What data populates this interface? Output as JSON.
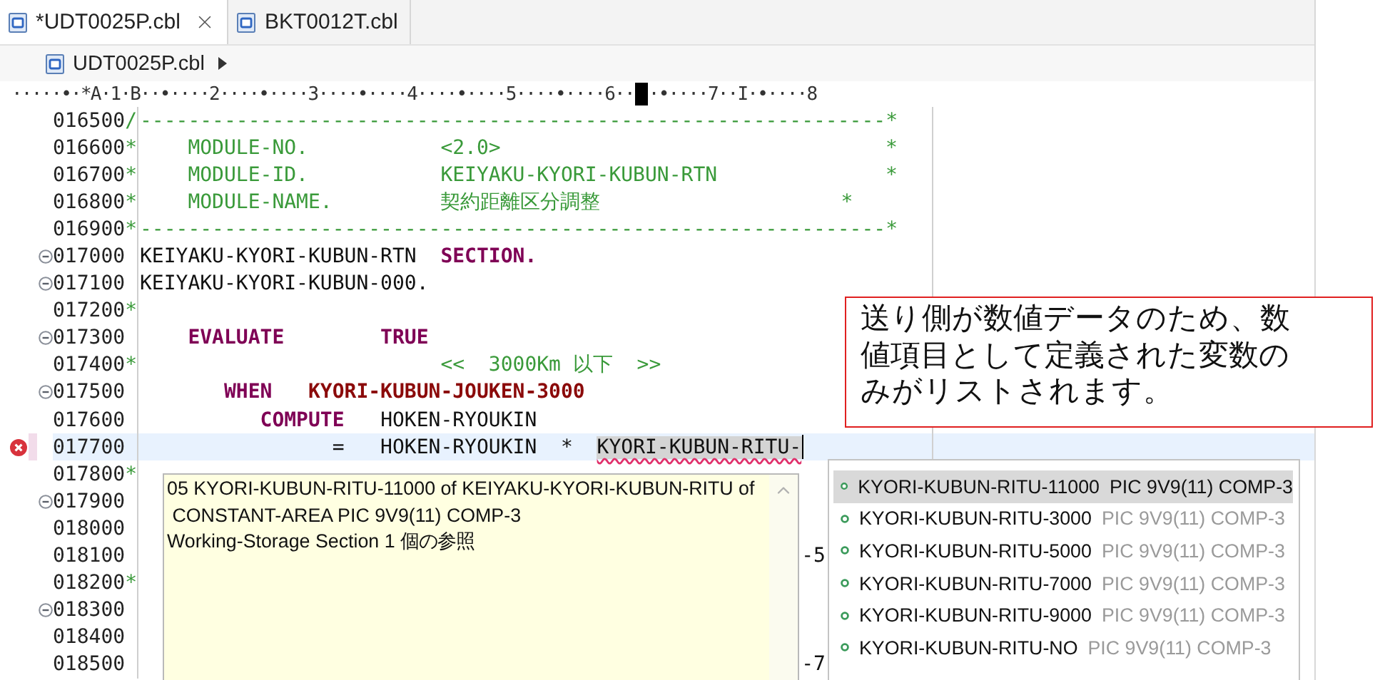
{
  "tabs": [
    {
      "label": "*UDT0025P.cbl",
      "selected": true
    },
    {
      "label": "BKT0012T.cbl",
      "selected": false
    }
  ],
  "breadcrumb": {
    "label": "UDT0025P.cbl"
  },
  "ruler": {
    "left": "·····•·*A·1·B··•····2····•····3····•····4····•····5····•····6··",
    "right": "·•····7··I·•····8"
  },
  "lines": [
    {
      "number": "016500",
      "indicator": "/",
      "fold": false,
      "error": false,
      "current": false,
      "segments": [
        {
          "text": "--------------------------------------------------------------*",
          "kind": "comment"
        }
      ]
    },
    {
      "number": "016600",
      "indicator": "*",
      "fold": false,
      "error": false,
      "current": false,
      "segments": [
        {
          "text": "    MODULE-NO.           <2.0>                                *",
          "kind": "comment"
        }
      ]
    },
    {
      "number": "016700",
      "indicator": "*",
      "fold": false,
      "error": false,
      "current": false,
      "segments": [
        {
          "text": "    MODULE-ID.           KEIYAKU-KYORI-KUBUN-RTN              *",
          "kind": "comment"
        }
      ]
    },
    {
      "number": "016800",
      "indicator": "*",
      "fold": false,
      "error": false,
      "current": false,
      "segments": [
        {
          "text": "    MODULE-NAME.         契約距離区分調整                    *",
          "kind": "comment"
        }
      ]
    },
    {
      "number": "016900",
      "indicator": "*",
      "fold": false,
      "error": false,
      "current": false,
      "segments": [
        {
          "text": "--------------------------------------------------------------*",
          "kind": "comment"
        }
      ]
    },
    {
      "number": "017000",
      "fold": true,
      "error": false,
      "current": false,
      "segments": [
        {
          "text": "KEIYAKU-KYORI-KUBUN-RTN",
          "kind": "plain"
        },
        {
          "text": "  SECTION.",
          "kind": "keyword"
        }
      ]
    },
    {
      "number": "017100",
      "fold": true,
      "error": false,
      "current": false,
      "segments": [
        {
          "text": "KEIYAKU-KYORI-KUBUN-000.",
          "kind": "plain"
        }
      ]
    },
    {
      "number": "017200",
      "indicator": "*",
      "fold": false,
      "error": false,
      "current": false
    },
    {
      "number": "017300",
      "fold": true,
      "error": false,
      "current": false,
      "segments": [
        {
          "text": "    EVALUATE",
          "kind": "keyword"
        },
        {
          "text": "        TRUE",
          "kind": "keyword"
        }
      ]
    },
    {
      "number": "017400",
      "indicator": "*",
      "fold": false,
      "error": false,
      "current": false,
      "segments": [
        {
          "text": "                         <<  3000Km 以下  >>",
          "kind": "comment"
        }
      ]
    },
    {
      "number": "017500",
      "fold": true,
      "error": false,
      "current": false,
      "segments": [
        {
          "text": "       WHEN",
          "kind": "keyword"
        },
        {
          "text": "   KYORI-KUBUN-JOUKEN-3000",
          "kind": "condition"
        }
      ]
    },
    {
      "number": "017600",
      "fold": false,
      "error": false,
      "current": false,
      "segments": [
        {
          "text": "          COMPUTE",
          "kind": "keyword"
        },
        {
          "text": "   HOKEN-RYOUKIN",
          "kind": "plain"
        }
      ]
    },
    {
      "number": "017700",
      "fold": false,
      "error": true,
      "current": true,
      "segments": [
        {
          "text": "                =   HOKEN-RYOUKIN  *  ",
          "kind": "plain"
        },
        {
          "text": "KYORI-KUBUN-RITU-",
          "kind": "marked"
        }
      ]
    },
    {
      "number": "017800",
      "indicator": "*",
      "fold": false,
      "error": false,
      "current": false
    },
    {
      "number": "017900",
      "fold": true,
      "error": false,
      "current": false
    },
    {
      "number": "018000",
      "fold": false,
      "error": false,
      "current": false
    },
    {
      "number": "018100",
      "fold": false,
      "error": false,
      "current": false,
      "segments": [
        {
          "text": "                                                       -5",
          "kind": "plain"
        }
      ]
    },
    {
      "number": "018200",
      "indicator": "*",
      "fold": false,
      "error": false,
      "current": false
    },
    {
      "number": "018300",
      "fold": true,
      "error": false,
      "current": false
    },
    {
      "number": "018400",
      "fold": false,
      "error": false,
      "current": false
    },
    {
      "number": "018500",
      "fold": false,
      "error": false,
      "current": false,
      "segments": [
        {
          "text": "                                                       -7",
          "kind": "plain"
        }
      ]
    }
  ],
  "hover": {
    "lines": [
      "05 KYORI-KUBUN-RITU-11000 of KEIYAKU-KYORI-KUBUN-RITU of\n CONSTANT-AREA PIC 9V9(11) COMP-3",
      "Working-Storage Section 1 個の参照"
    ]
  },
  "completions": [
    {
      "name": "KYORI-KUBUN-RITU-11000",
      "type": "PIC 9V9(11) COMP-3",
      "selected": true
    },
    {
      "name": "KYORI-KUBUN-RITU-3000",
      "type": "PIC 9V9(11) COMP-3",
      "selected": false
    },
    {
      "name": "KYORI-KUBUN-RITU-5000",
      "type": "PIC 9V9(11) COMP-3",
      "selected": false
    },
    {
      "name": "KYORI-KUBUN-RITU-7000",
      "type": "PIC 9V9(11) COMP-3",
      "selected": false
    },
    {
      "name": "KYORI-KUBUN-RITU-9000",
      "type": "PIC 9V9(11) COMP-3",
      "selected": false
    },
    {
      "name": "KYORI-KUBUN-RITU-NO",
      "type": "PIC 9V9(11) COMP-3",
      "selected": false
    }
  ],
  "callout": {
    "text": "送り側が数値データのため、数値項目として定義された変数のみがリストされます。"
  }
}
